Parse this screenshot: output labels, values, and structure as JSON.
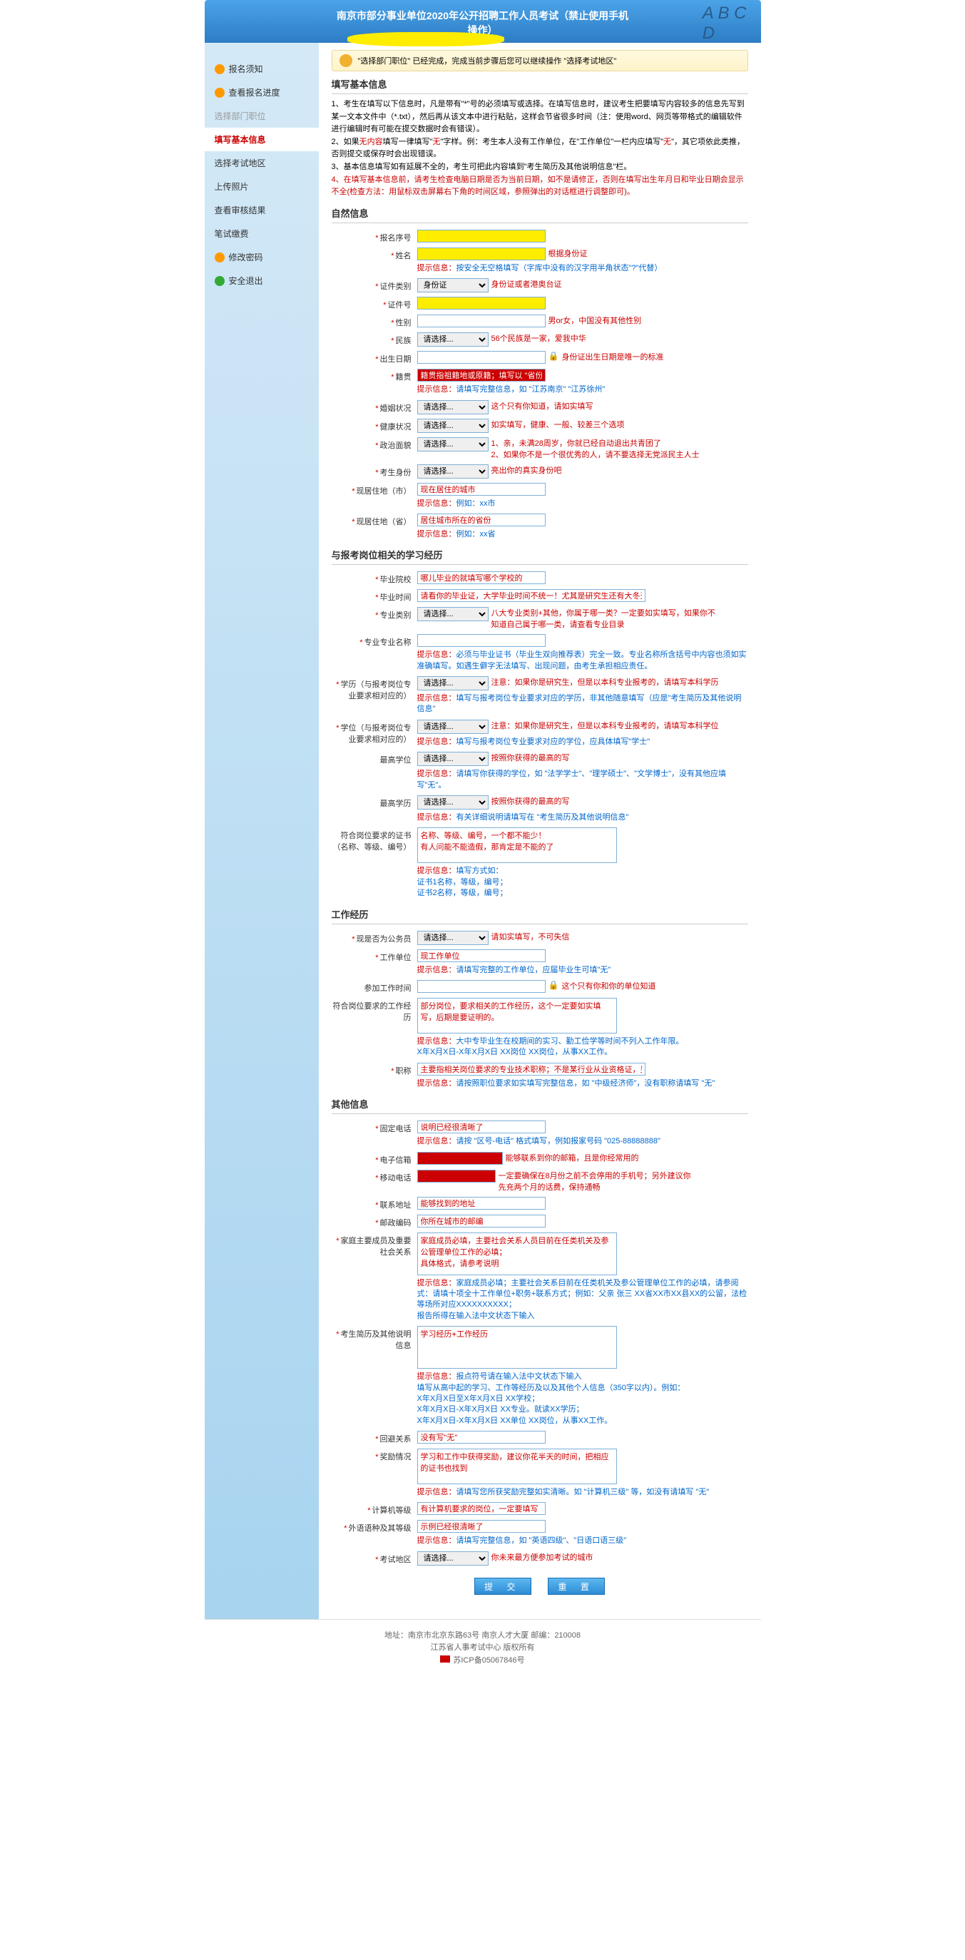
{
  "header": {
    "title": "南京市部分事业单位2020年公开招聘工作人员考试（禁止使用手机",
    "subtitle": "操作）"
  },
  "notice": "\"选择部门职位\" 已经完成，完成当前步骤后您可以继续操作 \"选择考试地区\"",
  "sidebar": [
    {
      "label": "报名须知",
      "icon": "orange"
    },
    {
      "label": "查看报名进度",
      "icon": "orange"
    },
    {
      "label": "选择部门职位",
      "muted": true
    },
    {
      "label": "填写基本信息",
      "active": true
    },
    {
      "label": "选择考试地区"
    },
    {
      "label": "上传照片"
    },
    {
      "label": "查看审核结果"
    },
    {
      "label": "笔试缴费"
    },
    {
      "label": "修改密码",
      "icon": "orange"
    },
    {
      "label": "安全退出",
      "icon": "green"
    }
  ],
  "sections": {
    "basic": "填写基本信息",
    "nature": "自然信息",
    "edu": "与报考岗位相关的学习经历",
    "work": "工作经历",
    "other": "其他信息"
  },
  "instructions": {
    "i1": "1、考生在填写以下信息时，凡是带有\"*\"号的必须填写或选择。在填写信息时，建议考生把要填写内容较多的信息先写到某一文本文件中（*.txt），然后再从该文本中进行粘贴，这样会节省很多时间（注：使用word、网页等带格式的编辑软件进行编辑时有可能在提交数据时会有错误）。",
    "i2a": "2、如果",
    "i2b": "无内容",
    "i2c": "填写一律填写\"",
    "i2d": "无",
    "i2e": "\"字样。例：考生本人没有工作单位，在\"工作单位\"一栏内应填写\"",
    "i2f": "无",
    "i2g": "\"，其它项依此类推，否则提交或保存时会出现错误。",
    "i3": "3、基本信息填写如有延展不全的，考生可把此内容填到\"考生简历及其他说明信息\"栏。",
    "i4": "4、在填写基本信息前，请考生检查电脑日期是否为当前日期，如不是请修正，否则在填写出生年月日和毕业日期会显示不全(检查方法：用鼠标双击屏幕右下角的时间区域，参照弹出的对话框进行调整即可)。"
  },
  "fields": {
    "bmxh": {
      "label": "报名序号"
    },
    "xm": {
      "label": "姓名",
      "hint": "提示信息：",
      "hint2": "按安全无空格填写（字库中没有的汉字用半角状态\"?\"代替）",
      "note": "根据身份证"
    },
    "zjlb": {
      "label": "证件类别",
      "opt": "身份证",
      "note": "身份证或者港奥台证"
    },
    "zjh": {
      "label": "证件号"
    },
    "xb": {
      "label": "性别",
      "note": "男or女，中国没有其他性别"
    },
    "mz": {
      "label": "民族",
      "opt": "请选择...",
      "note": "56个民族是一家，爱我中华"
    },
    "csrq": {
      "label": "出生日期",
      "note": "身份证出生日期是唯一的标准"
    },
    "jg": {
      "label": "籍贯",
      "val": "籍贯指祖籍地或原籍；填写以 \"省份+市区\" 的形式",
      "hint": "提示信息：",
      "hint2": "请填写完整信息，如 \"江苏南京\" \"江苏徐州\""
    },
    "hyzk": {
      "label": "婚姻状况",
      "opt": "请选择...",
      "note": "这个只有你知道，请如实填写"
    },
    "jkzk": {
      "label": "健康状况",
      "opt": "请选择...",
      "note": "如实填写，健康、一般、较差三个选项"
    },
    "zzmm": {
      "label": "政治面貌",
      "opt": "请选择...",
      "note1": "1、亲，未满28周岁，你就已经自动退出共青团了",
      "note2": "2、如果你不是一个很优秀的人，请不要选择无党派民主人士"
    },
    "kssf": {
      "label": "考生身份",
      "opt": "请选择...",
      "note": "亮出你的真实身份吧"
    },
    "xjzds": {
      "label": "现居住地（市）",
      "val": "现在居住的城市",
      "hint": "提示信息：",
      "hint2": "例如：xx市"
    },
    "xjzdp": {
      "label": "现居住地（省）",
      "val": "居住城市所在的省份",
      "hint": "提示信息：",
      "hint2": "例如：xx省"
    },
    "byyx": {
      "label": "毕业院校",
      "val": "哪儿毕业的就填写哪个学校的"
    },
    "bysh": {
      "label": "毕业时间",
      "val": "请看你的毕业证，大学毕业时间不统一！尤其是研究生还有大冬天毕业的"
    },
    "zylb": {
      "label": "专业类别",
      "opt": "请选择...",
      "note": "八大专业类别+其他，你属于哪一类？一定要如实填写，如果你不知道自己属于哪一类，请查看专业目录"
    },
    "zyzymc": {
      "label": "专业专业名称",
      "hint": "提示信息：",
      "hint2": "必须与毕业证书（毕业生双向推荐表）完全一致。专业名称所含括号中内容也须如实准确填写。如遇生僻字无法填写、出现问题，由考生承担相应责任。"
    },
    "xl": {
      "label": "学历（与报考岗位专业要求相对应的）",
      "opt": "请选择...",
      "note": "注意：如果你是研究生，但是以本科专业报考的，请填写本科学历",
      "hint": "提示信息：",
      "hint2": "填写与报考岗位专业要求对应的学历，非其他随意填写（应是\"考生简历及其他说明信息\""
    },
    "xw": {
      "label": "学位（与报考岗位专业要求相对应的）",
      "opt": "请选择...",
      "note": "注意：如果你是研究生，但是以本科专业报考的，请填写本科学位",
      "hint": "提示信息：",
      "hint2": "填写与报考岗位专业要求对应的学位，应具体填写\"学士\""
    },
    "zgxw": {
      "label": "最高学位",
      "opt": "请选择...",
      "note": "按照你获得的最高的写",
      "hint": "提示信息：",
      "hint2": "请填写你获得的学位，如 \"法学学士\"、\"理学硕士\"、\"文学博士\"，没有其他应填写\"无\"。"
    },
    "zgxl": {
      "label": "最高学历",
      "opt": "请选择...",
      "note": "按照你获得的最高的写",
      "hint": "提示信息：",
      "hint2": "有关详细说明请填写在 \"考生简历及其他说明信息\""
    },
    "fhgw": {
      "label": "符合岗位要求的证书（名称、等级、编号）",
      "val": "名称、等级、编号，一个都不能少！\n有人问能不能造假，那肯定是不能的了",
      "hint": "提示信息：",
      "hint2": "填写方式如：\n证书1名称，等级，编号；\n证书2名称，等级，编号；"
    },
    "xsfgwy": {
      "label": "现是否为公务员",
      "opt": "请选择...",
      "note": "请如实填写，不可失信"
    },
    "gzdw": {
      "label": "工作单位",
      "val": "现工作单位",
      "hint": "提示信息：",
      "hint2": "请填写完整的工作单位，应届毕业生可填\"无\""
    },
    "cjgzsj": {
      "label": "参加工作时间",
      "note": "这个只有你和你的单位知道"
    },
    "fhgwyq": {
      "label": "符合岗位要求的工作经历",
      "val": "部分岗位，要求相关的工作经历，这个一定要如实填写，后期是要证明的。",
      "hint": "提示信息：",
      "hint2": "大中专毕业生在校期间的实习、勤工俭学等时间不列入工作年限。\nX年X月X日-X年X月X日 XX岗位 XX岗位，从事XX工作。"
    },
    "zc": {
      "label": "职称",
      "val": "主要指相关岗位要求的专业技术职称；不是某行业从业资格证，另dei",
      "hint": "提示信息：",
      "hint2": "请按照职位要求如实填写完整信息，如 \"中级经济师\"，没有职称请填写 \"无\""
    },
    "gddh": {
      "label": "固定电话",
      "val": "说明已经很清晰了",
      "hint": "提示信息：",
      "hint2": "请按 \"区号-电话\" 格式填写，例如报家号码 \"025-88888888\""
    },
    "dzxx": {
      "label": "电子信箱",
      "note": "能够联系到你的邮箱，且是你经常用的"
    },
    "yddh": {
      "label": "移动电话",
      "note": "一定要确保在8月份之前不会停用的手机号；另外建议你先充两个月的话费，保持通畅"
    },
    "lxdz": {
      "label": "联系地址",
      "val": "能够找到的地址"
    },
    "yzbm": {
      "label": "邮政编码",
      "val": "你所在城市的邮编"
    },
    "jtcy": {
      "label": "家庭主要成员及重要社会关系",
      "val": "家庭成员必填，主要社会关系人员目前在任类机关及参公管理单位工作的必填；\n具体格式，请参考说明",
      "hint": "提示信息：",
      "hint2": "家庭成员必填；主要社会关系目前在任类机关及参公管理单位工作的必填，请参阅式：请填十项全十工作单位+职务+联系方式；例如：父亲  张三  XX省XX市XX县XX的公留，法检等场所对应XXXXXXXXXX；\n报告所得在输入法中文状态下输入"
    },
    "ksjl": {
      "label": "考生简历及其他说明信息",
      "val": "学习经历+工作经历",
      "hint": "提示信息：",
      "hint2": "报点符号请在输入法中文状态下输入\n填写从高中起的学习、工作等经历及以及其他个人信息（350字以内）。例如：\nX年X月X日至X年X月X日  XX学校；\nX年X月X日-X年X月X日  XX专业。就读XX学历；\nX年X月X日-X年X月X日  XX单位 XX岗位，从事XX工作。"
    },
    "tygx": {
      "label": "回避关系",
      "val": "没有写\"无\""
    },
    "jlqk": {
      "label": "奖励情况",
      "val": "学习和工作中获得奖励，建议你花半天的时间，把相应的证书也找到",
      "hint": "提示信息：",
      "hint2": "请填写您所获奖励完整如实清晰。如 \"计算机三级\" 等，如没有请填写 \"无\""
    },
    "jsjdj": {
      "label": "计算机等级",
      "val": "有计算机要求的岗位，一定要填写"
    },
    "wyyz": {
      "label": "外语语种及其等级",
      "val": "示例已经很清晰了",
      "hint": "提示信息：",
      "hint2": "请填写完整信息，如 \"英语四级\"、\"日语口语三级\""
    },
    "ksdq": {
      "label": "考试地区",
      "opt": "请选择...",
      "note": "你未来最方便参加考试的城市"
    }
  },
  "buttons": {
    "submit": "提 交",
    "reset": "重 置"
  },
  "footer": {
    "l1": "地址：南京市北京东路63号 南京人才大厦  邮编：210008",
    "l2": "江苏省人事考试中心  版权所有",
    "l3": "苏ICP备05067846号"
  }
}
